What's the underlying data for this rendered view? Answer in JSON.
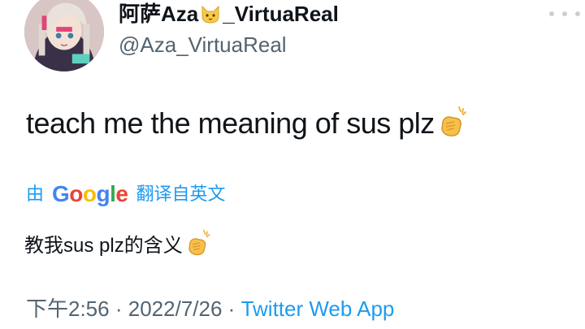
{
  "header": {
    "display_name_prefix": "阿萨Aza",
    "display_name_suffix": "_VirtuaReal",
    "handle": "@Aza_VirtuaReal",
    "badge_icon": "cat-face-icon"
  },
  "tweet": {
    "text": "teach me the meaning of sus plz",
    "emoji": "clapping-hands-icon"
  },
  "translation": {
    "by_label": "由",
    "provider": "Google",
    "link_label": "翻译自英文",
    "translated_text": "教我sus plz的含义"
  },
  "meta": {
    "time": "下午2:56",
    "separator": "·",
    "date": "2022/7/26",
    "separator2": "·",
    "source": "Twitter Web App"
  },
  "colors": {
    "link": "#1d9bf0",
    "secondary_text": "#536471",
    "google_blue": "#4285f4",
    "google_red": "#ea4335",
    "google_yellow": "#fbbc05",
    "google_green": "#34a853"
  }
}
